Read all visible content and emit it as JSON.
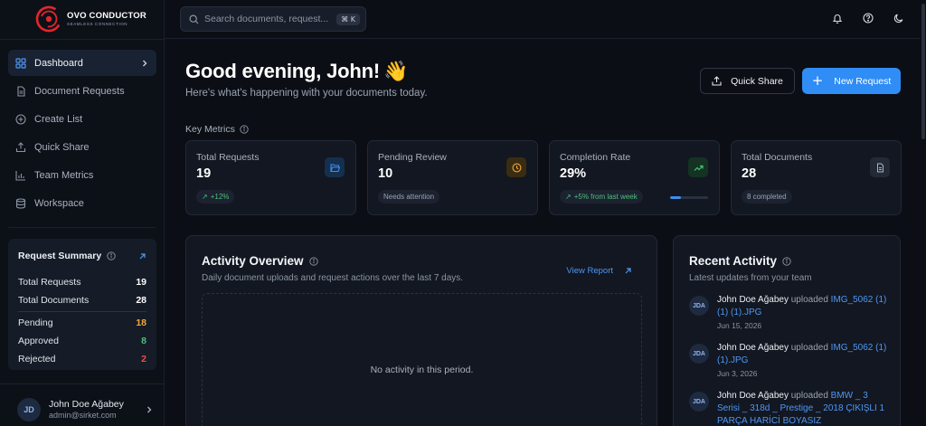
{
  "brand": {
    "name": "OVO CONDUCTOR",
    "tagline": "SEAMLESS CONNECTION"
  },
  "sidebar": {
    "items": [
      {
        "label": "Dashboard",
        "icon": "dashboard-icon",
        "active": true
      },
      {
        "label": "Document Requests",
        "icon": "document-icon"
      },
      {
        "label": "Create List",
        "icon": "plus-circle-icon"
      },
      {
        "label": "Quick Share",
        "icon": "share-icon"
      },
      {
        "label": "Team Metrics",
        "icon": "bar-chart-icon"
      },
      {
        "label": "Workspace",
        "icon": "database-icon"
      }
    ],
    "summary": {
      "title": "Request Summary",
      "rows": [
        {
          "label": "Total Requests",
          "value": "19",
          "color": "#ffffff"
        },
        {
          "label": "Total Documents",
          "value": "28",
          "color": "#ffffff"
        },
        {
          "label": "Pending",
          "value": "18",
          "color": "#f2a93b"
        },
        {
          "label": "Approved",
          "value": "8",
          "color": "#4cc07a"
        },
        {
          "label": "Rejected",
          "value": "2",
          "color": "#ef4c4c"
        }
      ]
    },
    "user": {
      "initials": "JD",
      "name": "John Doe Ağabey",
      "email": "admin@sirket.com"
    }
  },
  "topbar": {
    "search_placeholder": "Search documents, request...",
    "shortcut": "⌘ K"
  },
  "main": {
    "greeting": "Good evening, John!",
    "greeting_emoji": "👋",
    "subtitle": "Here's what's happening with your documents today.",
    "quick_share_label": "Quick Share",
    "new_request_label": "New Request",
    "key_metrics_label": "Key Metrics",
    "metrics": [
      {
        "title": "Total Requests",
        "value": "19",
        "badge": "+12%",
        "badge_style": "green",
        "icon": "folder-open-icon",
        "icon_color": "#3d8ef2",
        "icon_bg": "#15304f"
      },
      {
        "title": "Pending Review",
        "value": "10",
        "badge": "Needs attention",
        "badge_style": "gray",
        "icon": "clock-icon",
        "icon_color": "#f2a93b",
        "icon_bg": "#3a2c12"
      },
      {
        "title": "Completion Rate",
        "value": "29%",
        "badge": "+5% from last week",
        "badge_style": "green",
        "icon": "trending-up-icon",
        "icon_color": "#4cc07a",
        "icon_bg": "#143322",
        "progress": 29
      },
      {
        "title": "Total Documents",
        "value": "28",
        "badge": "8 completed",
        "badge_style": "gray",
        "icon": "file-icon",
        "icon_color": "#aab2bf",
        "icon_bg": "#232a36"
      }
    ],
    "activity_overview": {
      "title": "Activity Overview",
      "subtitle": "Daily document uploads and request actions over the last 7 days.",
      "view_report": "View Report",
      "empty": "No activity in this period."
    },
    "recent_activity": {
      "title": "Recent Activity",
      "subtitle": "Latest updates from your team",
      "items": [
        {
          "initials": "JDA",
          "user": "John Doe Ağabey",
          "verb": "uploaded",
          "file": "IMG_5062 (1) (1) (1).JPG",
          "date": "Jun 15, 2026"
        },
        {
          "initials": "JDA",
          "user": "John Doe Ağabey",
          "verb": "uploaded",
          "file": "IMG_5062 (1) (1).JPG",
          "date": "Jun 3, 2026"
        },
        {
          "initials": "JDA",
          "user": "John Doe Ağabey",
          "verb": "uploaded",
          "file": "BMW _ 3 Serisi _ 318d _ Prestige _ 2018 ÇIKIŞLI 1 PARÇA HARİCİ BOYASIZ",
          "date": ""
        }
      ]
    }
  }
}
